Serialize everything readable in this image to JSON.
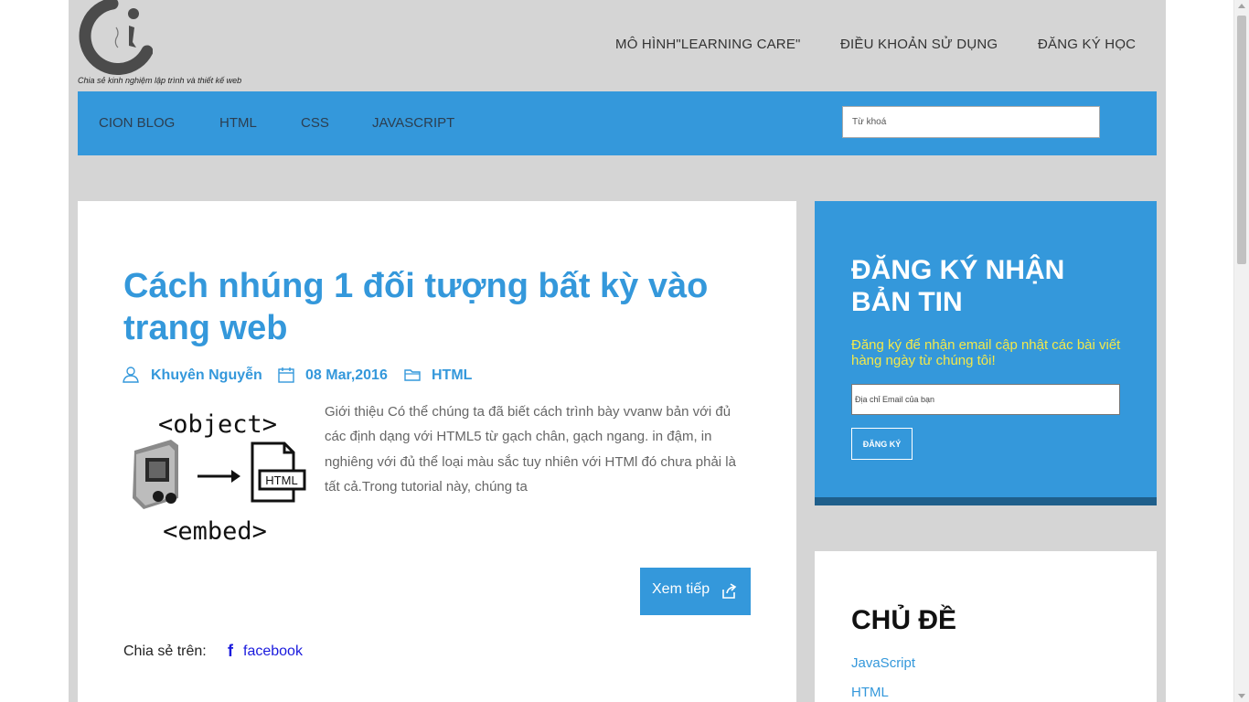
{
  "header": {
    "tagline": "Chia sẻ kinh nghiệm lập trình và thiết kế web",
    "nav": [
      "MÔ HÌNH\"LEARNING CARE\"",
      "ĐIỀU KHOẢN SỬ DỤNG",
      "ĐĂNG KÝ HỌC"
    ]
  },
  "menu": {
    "items": [
      "CION BLOG",
      "HTML",
      "CSS",
      "JAVASCRIPT"
    ],
    "search_placeholder": "Từ khoá"
  },
  "post": {
    "title": "Cách nhúng 1 đối tượng bất kỳ vào trang web",
    "author": "Khuyên Nguyễn",
    "date": "08 Mar,2016",
    "category": "HTML",
    "thumbnail": {
      "top_text": "<object>",
      "bottom_text": "<embed>",
      "file_label": "HTML"
    },
    "excerpt": "Giới thiệu Có thể chúng ta đã biết cách trình bày vvanw bản với đủ các định dạng với HTML5 từ gạch chân, gạch ngang. in đậm, in nghiêng với đủ thể loại màu sắc tuy nhiên với HTMl đó chưa phải là tất cả.Trong tutorial này, chúng ta",
    "read_more": "Xem tiếp",
    "share_label": "Chia sẻ trên:",
    "share_facebook": "facebook"
  },
  "newsletter": {
    "title": "ĐĂNG KÝ NHẬN BẢN TIN",
    "description": "Đăng ký để nhận email cập nhật các bài viết hàng ngày từ chúng tôi!",
    "email_placeholder": "Địa chỉ Email của bạn",
    "button": "ĐĂNG KÝ"
  },
  "topics": {
    "title": "CHỦ ĐỀ",
    "items": [
      "JavaScript",
      "HTML"
    ]
  },
  "colors": {
    "accent": "#3498db",
    "page_bg": "#d5d5d5",
    "newsletter_text": "#f3e84a",
    "newsletter_border": "#1f5f8b"
  },
  "icons": [
    "logo-mark",
    "user-icon",
    "calendar-icon",
    "folder-icon",
    "share-icon",
    "facebook-icon"
  ]
}
